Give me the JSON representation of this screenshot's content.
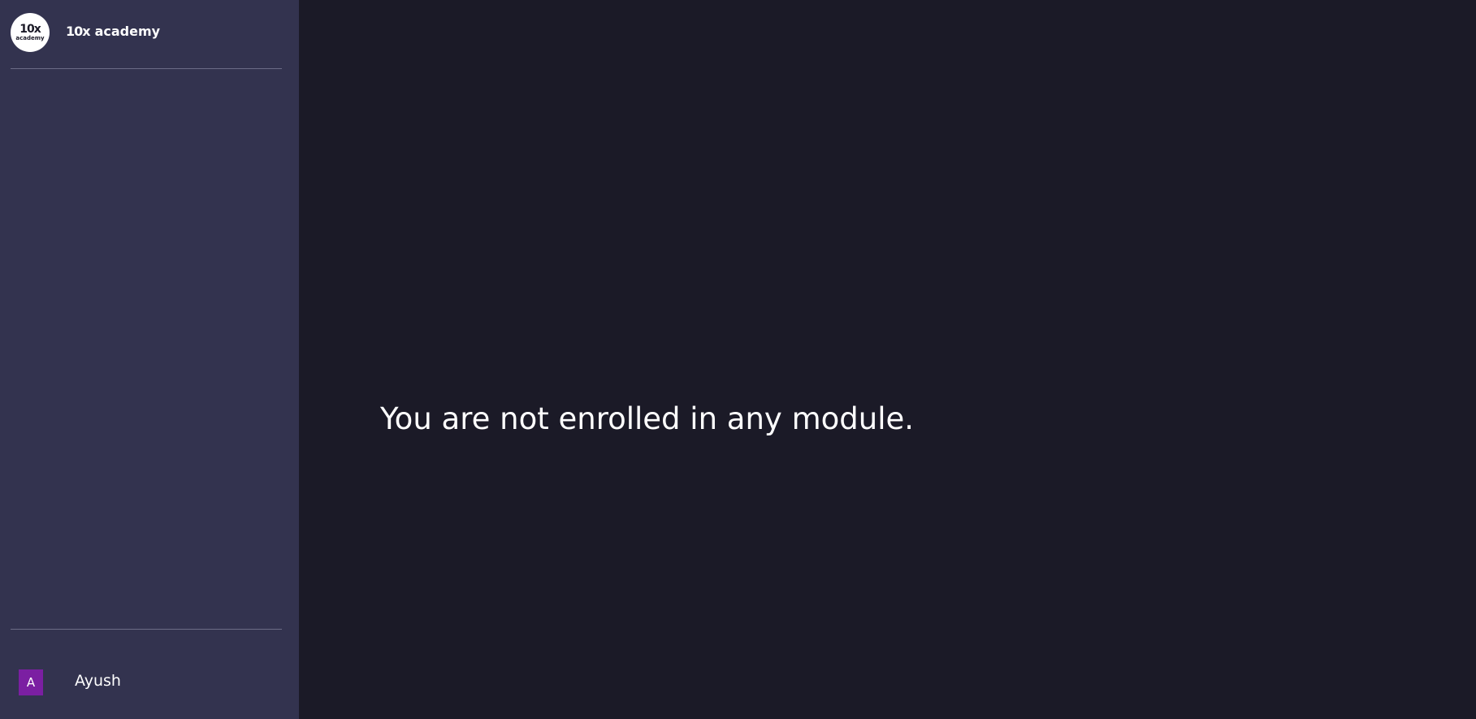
{
  "sidebar": {
    "logo": {
      "mark": "10x",
      "sub": "academy"
    },
    "brand": {
      "mark": "10x",
      "name": "academy"
    },
    "user": {
      "initial": "A",
      "name": "Ayush",
      "avatar_color": "#7b1fa2"
    },
    "background_color": "#33334f"
  },
  "main": {
    "message": "You are not enrolled in any module.",
    "background_color": "#1b1a27"
  }
}
